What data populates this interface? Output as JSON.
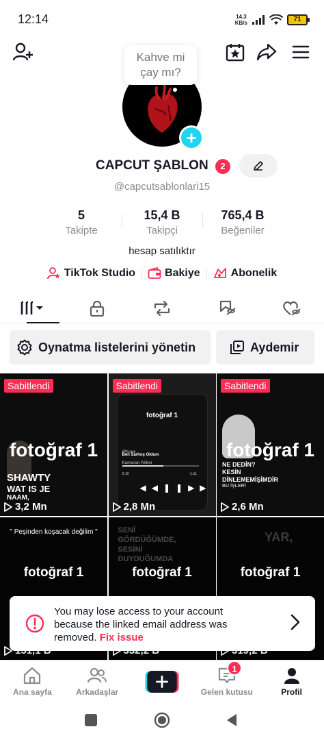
{
  "status": {
    "time": "12:14",
    "net_speed_value": "14,3",
    "net_speed_unit": "KB/s",
    "battery": "71"
  },
  "bubble": {
    "text_line1": "Kahve mi",
    "text_line2": "çay mı?"
  },
  "profile": {
    "name": "CAPCUT ŞABLON",
    "notif_count": "2",
    "handle": "@capcutsablonlari15",
    "bio": "hesap satılıktır"
  },
  "stats": [
    {
      "value": "5",
      "label": "Takipte"
    },
    {
      "value": "15,4 B",
      "label": "Takipçi"
    },
    {
      "value": "765,4 B",
      "label": "Beğeniler"
    }
  ],
  "links": [
    {
      "label": "TikTok Studio",
      "icon": "studio-icon"
    },
    {
      "label": "Bakiye",
      "icon": "wallet-icon"
    },
    {
      "label": "Abonelik",
      "icon": "subscription-icon"
    }
  ],
  "actions": {
    "playlists": "Oynatma listelerini yönetin",
    "aydemir": "Aydemir"
  },
  "grid": {
    "pinned_label": "Sabitlendi",
    "items": [
      {
        "title": "fotoğraf 1",
        "views": "3,2 Mn",
        "caption1": "SHAWTY",
        "caption2": "WAT IS JE",
        "caption3": "NAAM,"
      },
      {
        "title": "fotoğraf 1",
        "views": "2,8 Mn",
        "song": "Ben Sarhoş Oldum",
        "artist": "Kamuran Akkor",
        "platform": "iPhone",
        "time_start": "2:10",
        "time_end": "-1:11"
      },
      {
        "title": "fotoğraf 1",
        "views": "2,6 Mn",
        "caption1": "NE DEDİN?",
        "caption2": "KESİN",
        "caption3": "DİNLEMEMİŞİMDİR",
        "caption4": "BU İŞLERİ"
      },
      {
        "title": "fotoğraf 1",
        "views": "151,1 B",
        "caption1": "\" Peşinden koşacak değilim \""
      },
      {
        "title": "fotoğraf 1",
        "views": "332,2 B",
        "caption1": "SENİ",
        "caption2": "GÖRDÜĞÜMDE,",
        "caption3": "SESİNİ",
        "caption4": "DUYDUĞUMDA"
      },
      {
        "title": "fotoğraf 1",
        "views": "319,2 B",
        "caption1": "YAR,"
      }
    ]
  },
  "notice": {
    "message": "You may lose access to your account because the linked email address was removed.",
    "action": "Fix issue"
  },
  "nav": {
    "home": "Ana sayfa",
    "friends": "Arkadaşlar",
    "inbox": "Gelen kutusu",
    "inbox_badge": "1",
    "profile": "Profil"
  },
  "colors": {
    "accent": "#fe2c55",
    "cyan": "#20d5ec",
    "text": "#161823",
    "muted": "#8a8b91"
  }
}
